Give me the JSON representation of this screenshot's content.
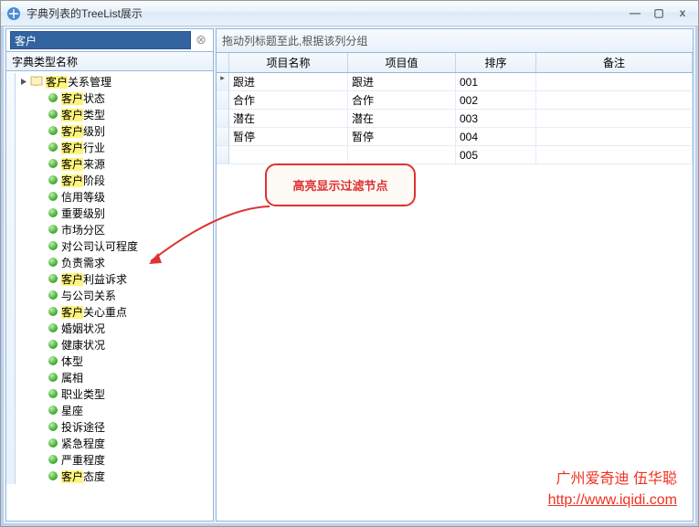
{
  "window": {
    "title": "字典列表的TreeList展示"
  },
  "search": {
    "value": "客户"
  },
  "tree": {
    "header": "字典类型名称",
    "root": {
      "label_pre": "",
      "label_hl": "客户",
      "label_post": "关系管理"
    },
    "children": [
      {
        "pre": "",
        "hl": "客户",
        "post": "状态"
      },
      {
        "pre": "",
        "hl": "客户",
        "post": "类型"
      },
      {
        "pre": "",
        "hl": "客户",
        "post": "级别"
      },
      {
        "pre": "",
        "hl": "客户",
        "post": "行业"
      },
      {
        "pre": "",
        "hl": "客户",
        "post": "来源"
      },
      {
        "pre": "",
        "hl": "客户",
        "post": "阶段"
      },
      {
        "pre": "信用等级",
        "hl": "",
        "post": ""
      },
      {
        "pre": "重要级别",
        "hl": "",
        "post": ""
      },
      {
        "pre": "市场分区",
        "hl": "",
        "post": ""
      },
      {
        "pre": "对公司认可程度",
        "hl": "",
        "post": ""
      },
      {
        "pre": "负责需求",
        "hl": "",
        "post": ""
      },
      {
        "pre": "",
        "hl": "客户",
        "post": "利益诉求"
      },
      {
        "pre": "与公司关系",
        "hl": "",
        "post": ""
      },
      {
        "pre": "",
        "hl": "客户",
        "post": "关心重点"
      },
      {
        "pre": "婚姻状况",
        "hl": "",
        "post": ""
      },
      {
        "pre": "健康状况",
        "hl": "",
        "post": ""
      },
      {
        "pre": "体型",
        "hl": "",
        "post": ""
      },
      {
        "pre": "属相",
        "hl": "",
        "post": ""
      },
      {
        "pre": "职业类型",
        "hl": "",
        "post": ""
      },
      {
        "pre": "星座",
        "hl": "",
        "post": ""
      },
      {
        "pre": "投诉途径",
        "hl": "",
        "post": ""
      },
      {
        "pre": "紧急程度",
        "hl": "",
        "post": ""
      },
      {
        "pre": "严重程度",
        "hl": "",
        "post": ""
      },
      {
        "pre": "",
        "hl": "客户",
        "post": "态度"
      }
    ]
  },
  "grid": {
    "group_hint": "拖动列标题至此,根据该列分组",
    "columns": {
      "name": "项目名称",
      "value": "项目值",
      "sort": "排序",
      "remark": "备注"
    },
    "rows": [
      {
        "name": "跟进",
        "value": "跟进",
        "sort": "001",
        "remark": "",
        "current": true
      },
      {
        "name": "合作",
        "value": "合作",
        "sort": "002",
        "remark": ""
      },
      {
        "name": "潜在",
        "value": "潜在",
        "sort": "003",
        "remark": ""
      },
      {
        "name": "暂停",
        "value": "暂停",
        "sort": "004",
        "remark": ""
      },
      {
        "name": "",
        "value": "",
        "sort": "005",
        "remark": ""
      }
    ]
  },
  "callout": {
    "text": "高亮显示过滤节点"
  },
  "watermark": {
    "line1": "广州爱奇迪 伍华聪",
    "line2": "http://www.iqidi.com"
  }
}
